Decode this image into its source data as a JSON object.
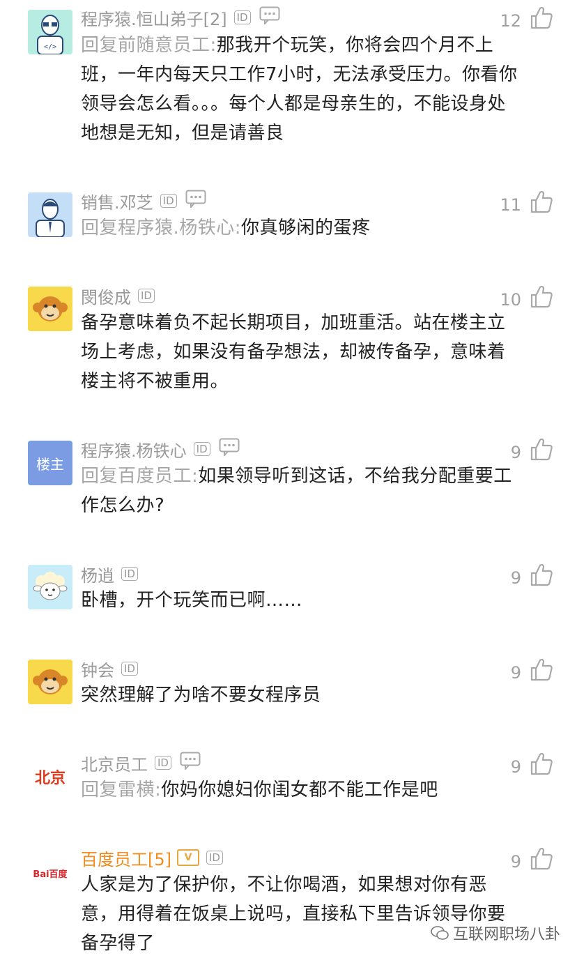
{
  "comments": [
    {
      "name": "程序猿.恒山弟子[2]",
      "id_badge": "ID",
      "likes": "12",
      "reply_prefix": "回复前随意员工:",
      "text": "那我开个玩笑，你将会四个月不上班，一年内每天只工作7小时，无法承受压力。你看你领导会怎么看。。。每个人都是母亲生的，不能设身处地想是无知，但是请善良",
      "avatar": "programmer-avatar"
    },
    {
      "name": "销售.邓芝",
      "id_badge": "ID",
      "likes": "11",
      "reply_prefix": "回复程序猿.杨铁心:",
      "text": "你真够闲的蛋疼",
      "avatar": "salesman-avatar"
    },
    {
      "name": "閔俊成",
      "id_badge": "ID",
      "likes": "10",
      "reply_prefix": "",
      "text": "备孕意味着负不起长期项目，加班重活。站在楼主立场上考虑，如果没有备孕想法，却被传备孕，意味着楼主将不被重用。",
      "avatar": "monkey-avatar"
    },
    {
      "name": "程序猿.杨铁心",
      "id_badge": "ID",
      "likes": "9",
      "reply_prefix": "回复百度员工:",
      "text": "如果领导听到这话，不给我分配重要工作怎么办?",
      "avatar_text": "楼主"
    },
    {
      "name": "杨逍",
      "id_badge": "ID",
      "likes": "9",
      "reply_prefix": "",
      "text": "卧槽，开个玩笑而已啊……",
      "avatar": "sheep-avatar"
    },
    {
      "name": "钟会",
      "id_badge": "ID",
      "likes": "9",
      "reply_prefix": "",
      "text": "突然理解了为啥不要女程序员",
      "avatar": "monkey-avatar"
    },
    {
      "name": "北京员工",
      "id_badge": "ID",
      "likes": "9",
      "reply_prefix": "回复雷横:",
      "text": "你妈你媳妇你闺女都不能工作是吧",
      "avatar_text": "北京"
    },
    {
      "name": "百度员工[5]",
      "id_badge": "ID",
      "vip_badge": "V",
      "likes": "9",
      "reply_prefix": "",
      "text": "人家是为了保护你，不让你喝酒，如果想对你有恶意，用得着在饭桌上说吗，直接私下里告诉领导你要备孕得了",
      "avatar_text": "Bai百度"
    }
  ],
  "watermark": "互联网职场八卦"
}
